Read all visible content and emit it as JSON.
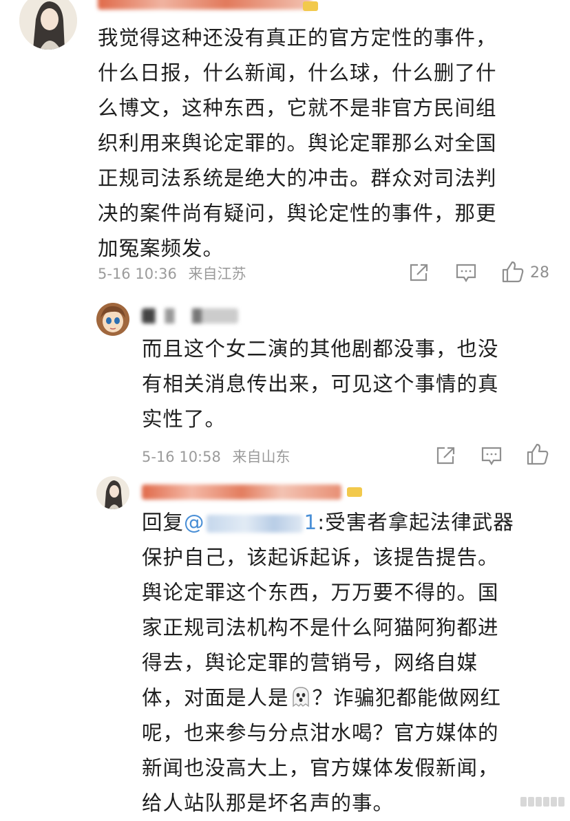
{
  "comments": [
    {
      "text": "我觉得这种还没有真正的官方定性的事件，\n什么日报，什么新闻，什么球，什么删了什\n么博文，这种东西，它就不是非官方民间组\n织利用来舆论定罪的。舆论定罪那么对全国\n正规司法系统是绝大的冲击。群众对司法判\n决的案件尚有疑问，舆论定性的事件，那更\n加冤案频发。",
      "time": "5-16 10:36",
      "location": "来自江苏",
      "likes": "28"
    },
    {
      "text": "而且这个女二演的其他剧都没事，也没\n有相关消息传出来，可见这个事情的真\n实性了。",
      "time": "5-16 10:58",
      "location": "来自山东",
      "likes": ""
    },
    {
      "reply_prefix": "回复",
      "mention_at": "@",
      "mention_tail": "1",
      "reply_after_mention": ":受害者拿起法律武器",
      "text_lines_before_emoji": "保护自己，该起诉起诉，该提告提告。\n舆论定罪这个东西，万万要不得的。国\n家正规司法机构不是什么阿猫阿狗都进\n得去，舆论定罪的营销号，网络自媒\n体，对面是人是",
      "text_after_emoji": "？诈骗犯都能做网红\n呢，也来参与分点泔水喝？官方媒体的\n新闻也没高大上，官方媒体发假新闻，\n给人站队那是坏名声的事。"
    }
  ],
  "icons": {
    "share": "share-icon",
    "comment": "comment-icon",
    "like": "thumbs-up-icon",
    "emoji": "ghost-emoji"
  },
  "colors": {
    "text": "#1f1f1f",
    "meta": "#9b9b9b",
    "mention": "#4a8fd6",
    "badge": "#f2c94c"
  }
}
